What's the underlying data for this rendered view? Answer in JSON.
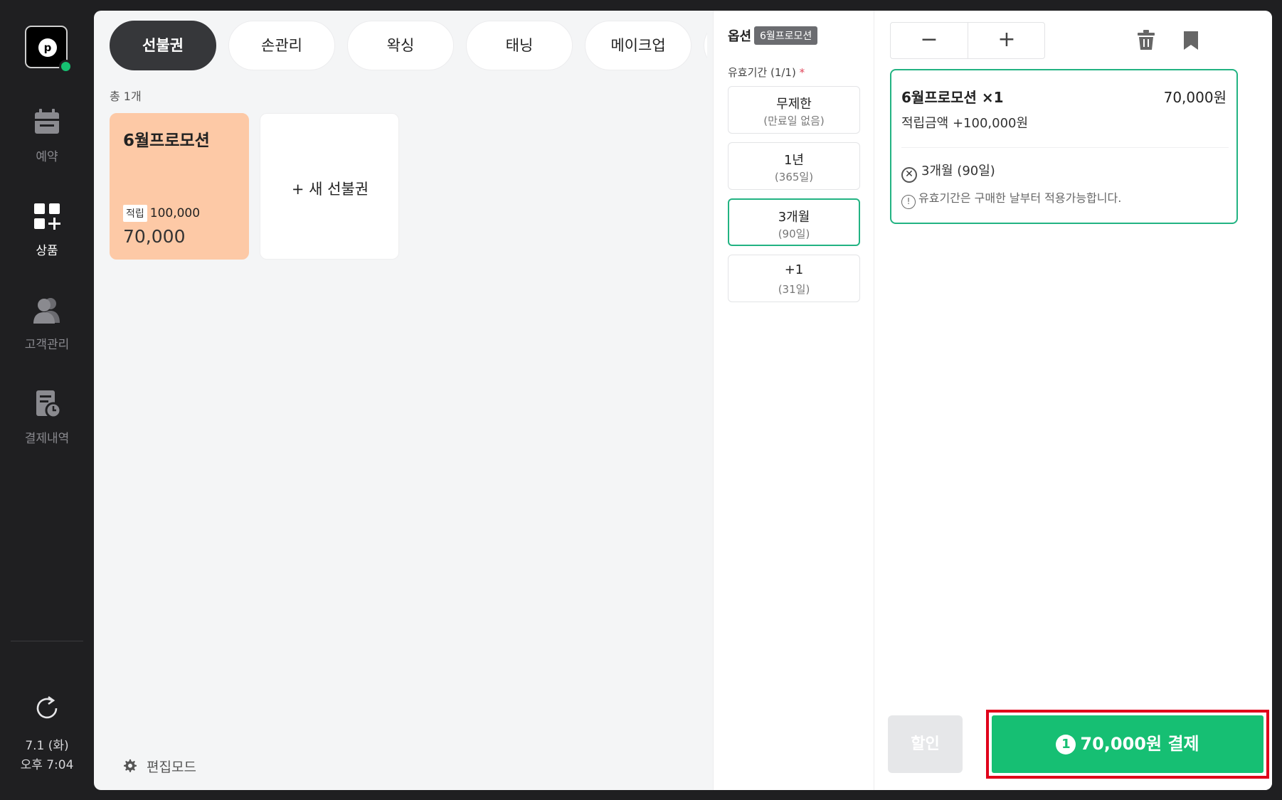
{
  "rail": {
    "logo_letter": "p",
    "items": [
      {
        "label": "예약"
      },
      {
        "label": "상품"
      },
      {
        "label": "고객관리"
      },
      {
        "label": "결제내역"
      }
    ],
    "date": "7.1 (화)",
    "time": "오후 7:04"
  },
  "tabs": [
    {
      "label": "선불권"
    },
    {
      "label": "손관리"
    },
    {
      "label": "왁싱"
    },
    {
      "label": "태닝"
    },
    {
      "label": "메이크업"
    }
  ],
  "products": {
    "count_text": "총 1개",
    "items": [
      {
        "title": "6월프로모션",
        "chip": "적립",
        "earn": "100,000",
        "price": "70,000"
      }
    ],
    "new_label": "+ 새 선불권"
  },
  "edit_mode_label": "편집모드",
  "options": {
    "header": "옵션",
    "badge": "6월프로모션",
    "validity_label": "유효기간 (1/1)",
    "required_mark": "*",
    "choices": [
      {
        "title": "무제한",
        "sub": "(만료일 없음)"
      },
      {
        "title": "1년",
        "sub": "(365일)"
      },
      {
        "title": "3개월",
        "sub": "(90일)"
      },
      {
        "title": "+1",
        "sub": "(31일)"
      }
    ]
  },
  "cart": {
    "minus": "−",
    "plus": "+",
    "item_name": "6월프로모션 ×1",
    "item_price": "70,000원",
    "earn_text": "적립금액 +100,000원",
    "option_text": "3개월 (90일)",
    "note": "유효기간은 구매한 날부터 적용가능합니다.",
    "discount_label": "할인",
    "pay_count": "1",
    "pay_label": "70,000원 결제"
  },
  "colors": {
    "accent": "#16bf73",
    "selected_border": "#22b382",
    "promo_card": "#fdc9a6",
    "highlight_box": "#e0001a"
  }
}
